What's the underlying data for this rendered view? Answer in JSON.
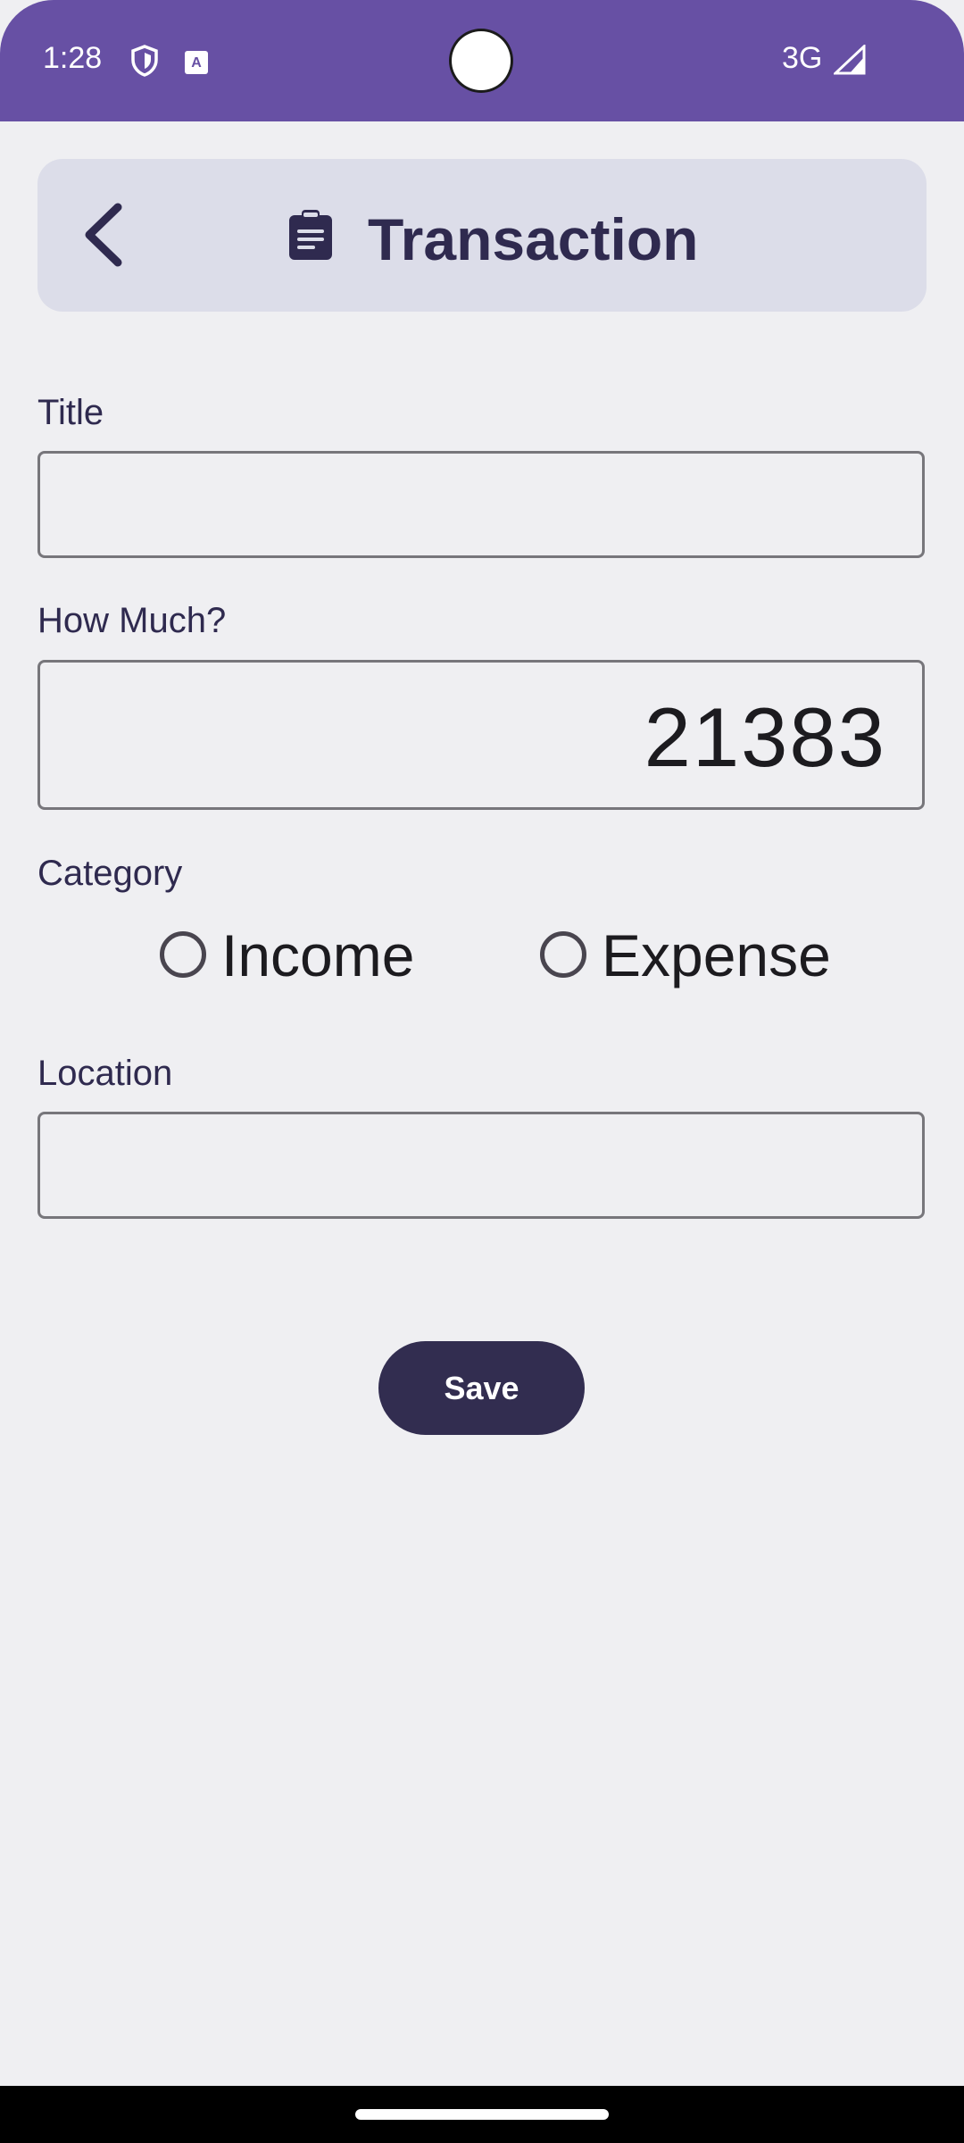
{
  "status_bar": {
    "time": "1:28",
    "network": "3G",
    "icons": [
      "shield-icon",
      "keyboard-a-icon",
      "signal-icon"
    ],
    "background_color": "#6750a4"
  },
  "header": {
    "title": "Transaction",
    "back_icon": "chevron-left-icon",
    "title_icon": "clipboard-icon"
  },
  "form": {
    "title_label": "Title",
    "title_value": "",
    "amount_label": "How Much?",
    "amount_value": "21383",
    "category_label": "Category",
    "category_options": [
      "Income",
      "Expense"
    ],
    "location_label": "Location",
    "location_value": ""
  },
  "actions": {
    "save_label": "Save",
    "save_color": "#322d50"
  }
}
